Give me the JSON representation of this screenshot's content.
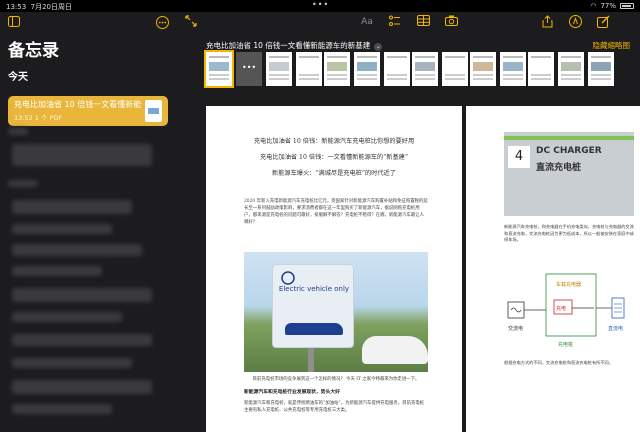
{
  "status": {
    "time": "13:53",
    "date": "7月20日周日",
    "battery": "77%"
  },
  "sidebar": {
    "title": "备忘录",
    "section": "今天",
    "note": {
      "title": "充电比加油省 10 倍钱一文看懂新能源车的新基建",
      "meta": "13:52  1 个 PDF"
    },
    "blur_labels": [
      "",
      "",
      ""
    ]
  },
  "toolbar": {
    "icons": [
      "collapse-icon",
      "text-format-icon",
      "checklist-icon",
      "table-icon",
      "camera-icon",
      "share-icon",
      "markup-icon",
      "compose-icon"
    ],
    "text_format": "Aa"
  },
  "document": {
    "title": "充电比加油省 10 倍钱一文看懂新能源车的新基建",
    "hide_thumbnails": "隐藏缩略图",
    "page1": {
      "heading": [
        "充电比加油省 10 倍钱：新能源汽车充电桩比你想的要好用",
        "充电比加油省 10 倍钱：一文看懂新能源车的“新基建”",
        "新能源车爆火：“满城尽是充电桩”的时代近了"
      ],
      "intro": "2020 年新入充电新能源汽车充电桩比亿元，受国家针对新能源汽车购置补贴和免征购置税的延长至一系列鼓励政策影响，要求消费者都在这一年里购买了新能源汽车，据说网购充电桩用户，都来源是充电桩的问题可最好，排服解不解答？充电桩不稳得？在哪，新能源汽车最让人哪好？",
      "sign_text": "Electric vehicle only",
      "caption": "目前充电桩市场的竞争展到这一个怎样的情况？ 今天 IT 之家今特邀来为你走进一下。",
      "subhead": "新能源汽车和充电桩行业发展现状，势头大好",
      "body": "新能源汽车和充电桩，就是传统燃油车的“加油站”，为新能源汽车提供充电服务，目前充电桩主要有私人充电桩、公共充电桩等专用充电桩三大类。"
    },
    "page2": {
      "charger_number": "4",
      "charger_en": "DC CHARGER",
      "charger_cn": "直流充电桩",
      "text": "新能源汽车充电桩，和充电器在手机充电类似，充电桩与充电器的交流和直流充电，交流充电桩因为更为低成本，所以一般被安装在家庭中或停车场。",
      "diagram_labels": [
        "交流电",
        "直流电",
        "车载充电器",
        "充电桩",
        "充电"
      ],
      "footer": "根据充电方式的不同，交流充电桩和直流充电桩有所不同。"
    }
  }
}
